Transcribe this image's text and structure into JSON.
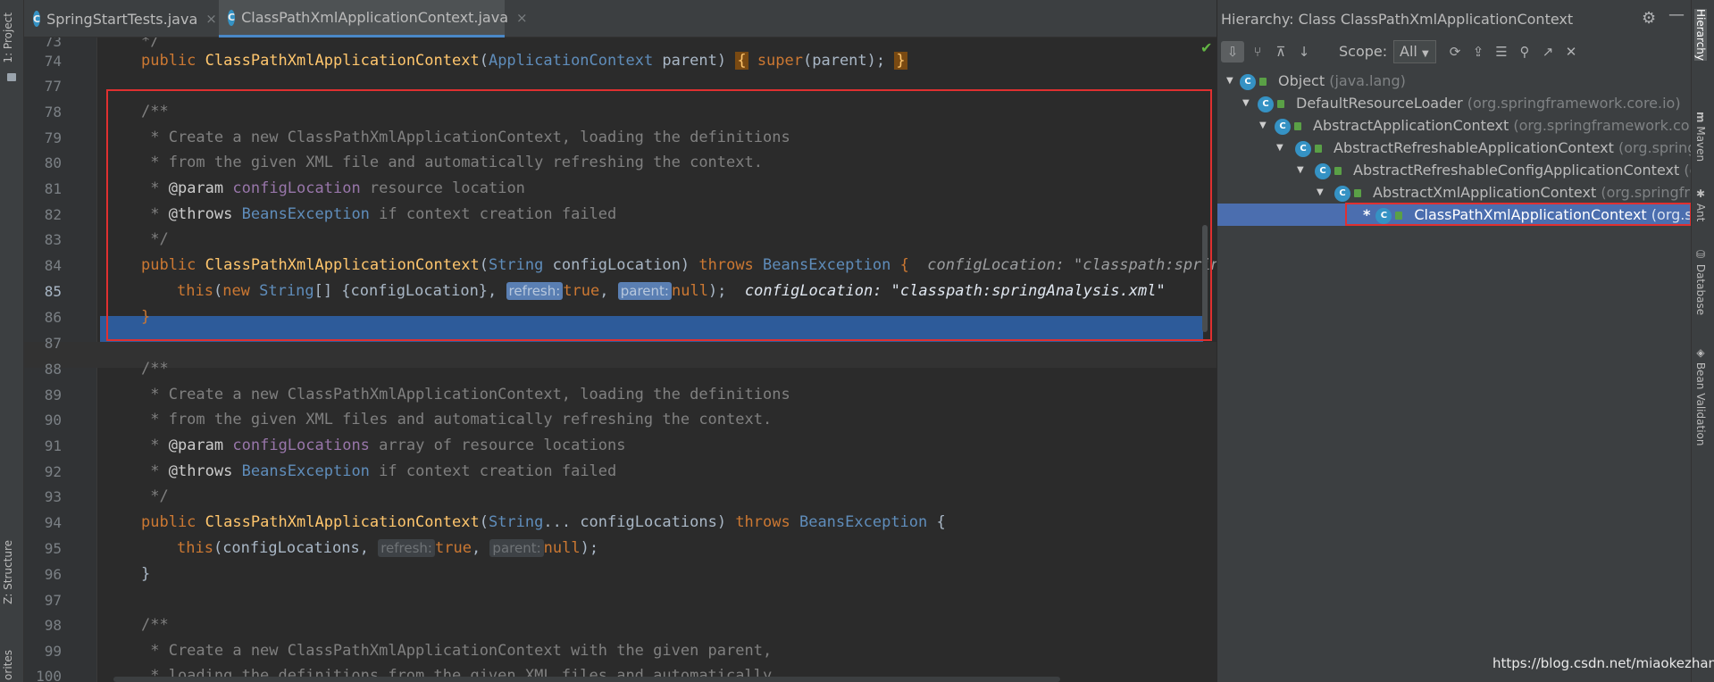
{
  "tabs": [
    {
      "name": "SpringStartTests.java",
      "active": false
    },
    {
      "name": "ClassPathXmlApplicationContext.java",
      "active": true
    }
  ],
  "left_strip": {
    "project": "1: Project",
    "structure": "Z: Structure",
    "favorites": "orites"
  },
  "editor": {
    "line_numbers": [
      "73",
      "74",
      "77",
      "78",
      "79",
      "80",
      "81",
      "82",
      "83",
      "84",
      "85",
      "86",
      "87",
      "88",
      "89",
      "90",
      "91",
      "92",
      "93",
      "94",
      "95",
      "96",
      "97",
      "98",
      "99",
      "100"
    ],
    "l73": "*/",
    "l74_pub": "public ",
    "l74_name": "ClassPathXmlApplicationContext",
    "l74_type": "ApplicationContext",
    "l74_rest": " parent) ",
    "l74_ob": "{",
    "l74_super": "super",
    "l74_call": "(parent);",
    "l74_cb": "}",
    "l78": "/**",
    "l79": " * Create a new ClassPathXmlApplicationContext, loading the definitions",
    "l80": " * from the given XML file and automatically refreshing the context.",
    "l81_star": " * ",
    "l81_tag": "@param",
    "l81_param": "configLocation",
    "l81_rest": " resource location",
    "l82_tag": "@throws",
    "l82_type": "BeansException",
    "l82_rest": " if context creation failed",
    "l83": " */",
    "l84_pub": "public ",
    "l84_name": "ClassPathXmlApplicationContext",
    "l84_type": "String",
    "l84_mid": " configLocation) ",
    "l84_throws": "throws ",
    "l84_ex": "BeansException",
    "l84_ob": " {",
    "l84_hint": "configLocation: \"classpath:springAn",
    "l85_this": "this",
    "l85_new": "new ",
    "l85_type": "String",
    "l85_args": "[] {configLocation}, ",
    "l85_h1": "refresh:",
    "l85_true": "true",
    "l85_h2": "parent:",
    "l85_null": "null",
    "l85_end": ");",
    "l85_hint": "configLocation: \"classpath:springAnalysis.xml\"",
    "l86": "}",
    "l88": "/**",
    "l89": " * Create a new ClassPathXmlApplicationContext, loading the definitions",
    "l90": " * from the given XML files and automatically refreshing the context.",
    "l91_param": "configLocations",
    "l91_rest": " array of resource locations",
    "l92_rest": " if context creation failed",
    "l93": " */",
    "l94_pub": "public ",
    "l94_name": "ClassPathXmlApplicationContext",
    "l94_type": "String",
    "l94_mid": "... configLocations) ",
    "l94_throws": "throws ",
    "l94_ex": "BeansException",
    "l94_ob": " {",
    "l95_this": "this",
    "l95_args": "(configLocations, ",
    "l95_h1": "refresh:",
    "l95_true": "true",
    "l95_h2": "parent:",
    "l95_null": "null",
    "l95_end": ");",
    "l96": "}",
    "l98": "/**",
    "l99": " * Create a new ClassPathXmlApplicationContext with the given parent,",
    "l100": " * loading the definitions from the given XML files and automatically"
  },
  "hierarchy": {
    "title": "Hierarchy:  Class ClassPathXmlApplicationContext",
    "scope_label": "Scope:",
    "scope_value": "All",
    "nodes": [
      {
        "name": "Object",
        "pkg": "(java.lang)"
      },
      {
        "name": "DefaultResourceLoader",
        "pkg": "(org.springframework.core.io)"
      },
      {
        "name": "AbstractApplicationContext",
        "pkg": "(org.springframework.context"
      },
      {
        "name": "AbstractRefreshableApplicationContext",
        "pkg": "(org.springfra"
      },
      {
        "name": "AbstractRefreshableConfigApplicationContext",
        "pkg": "(org"
      },
      {
        "name": "AbstractXmlApplicationContext",
        "pkg": "(org.springfram"
      },
      {
        "name": "ClassPathXmlApplicationContext",
        "pkg": "(org.sprin",
        "star": "*"
      }
    ]
  },
  "right_strip": {
    "hierarchy": "Hierarchy",
    "maven": "Maven",
    "ant": "Ant",
    "database": "Database",
    "bean_validation": "Bean Validation"
  },
  "watermark": "https://blog.csdn.net/miaokezhang"
}
